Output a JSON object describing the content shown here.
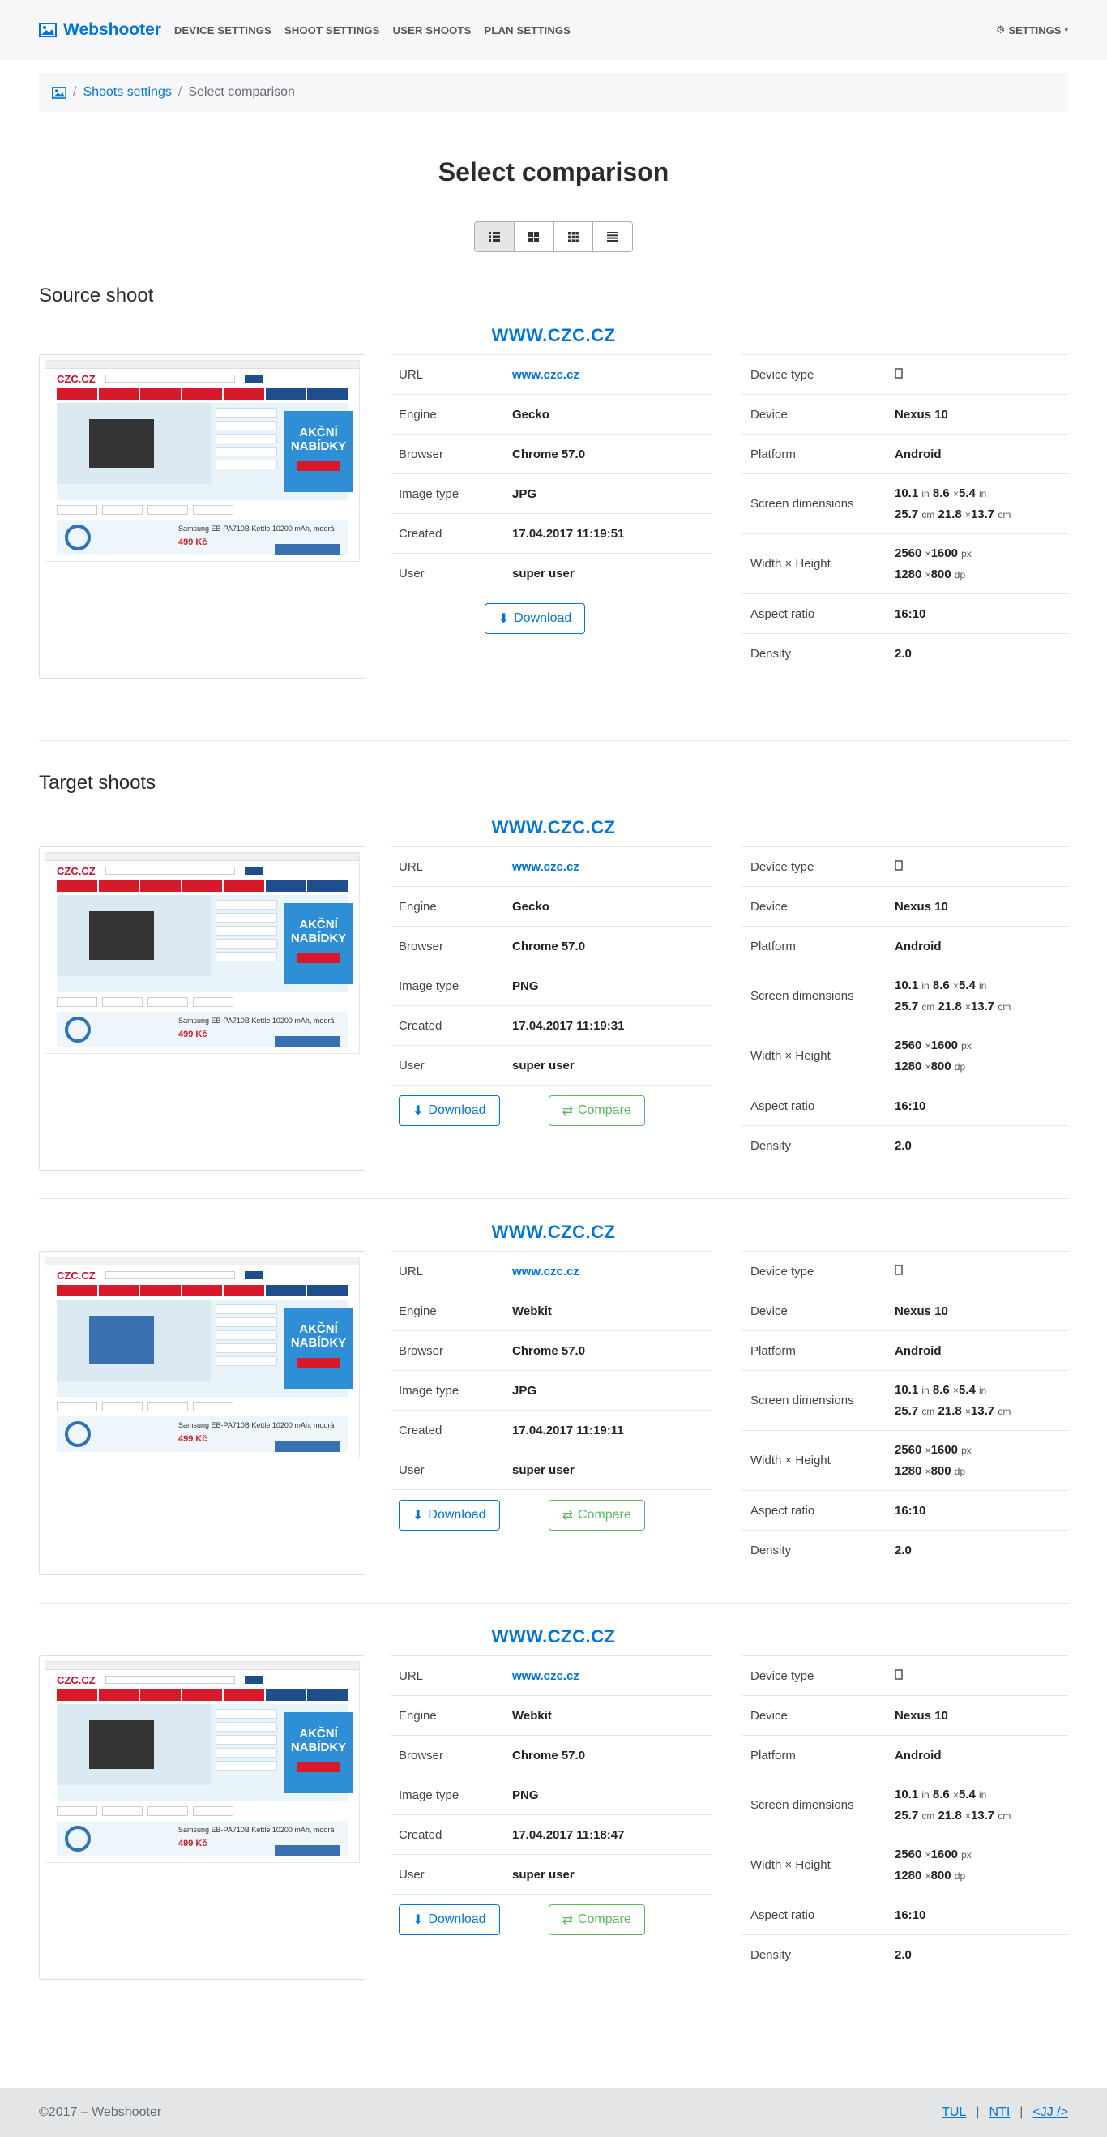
{
  "nav": {
    "brand": "Webshooter",
    "links": [
      "DEVICE SETTINGS",
      "SHOOT SETTINGS",
      "USER SHOOTS",
      "PLAN SETTINGS"
    ],
    "settings": "SETTINGS"
  },
  "breadcrumb": {
    "link": "Shoots settings",
    "current": "Select comparison"
  },
  "page_title": "Select comparison",
  "source_heading": "Source shoot",
  "target_heading": "Target shoots",
  "labels": {
    "url": "URL",
    "engine": "Engine",
    "browser": "Browser",
    "image_type": "Image type",
    "created": "Created",
    "user": "User",
    "device_type": "Device type",
    "device": "Device",
    "platform": "Platform",
    "screen_dimensions": "Screen dimensions",
    "width_height": "Width × Height",
    "aspect_ratio": "Aspect ratio",
    "density": "Density",
    "download": "Download",
    "compare": "Compare"
  },
  "shoots": [
    {
      "heading": "WWW.CZC.CZ",
      "url": "www.czc.cz",
      "engine": "Gecko",
      "browser": "Chrome 57.0",
      "image_type": "JPG",
      "created": "17.04.2017 11:19:51",
      "user": "super user",
      "device": "Nexus 10",
      "platform": "Android",
      "screen_in": [
        "10.1",
        "8.6",
        "5.4"
      ],
      "screen_cm": [
        "25.7",
        "21.8",
        "13.7"
      ],
      "px": [
        "2560",
        "1600"
      ],
      "dp": [
        "1280",
        "800"
      ],
      "aspect": "16:10",
      "density": "2.0"
    },
    {
      "heading": "WWW.CZC.CZ",
      "url": "www.czc.cz",
      "engine": "Gecko",
      "browser": "Chrome 57.0",
      "image_type": "PNG",
      "created": "17.04.2017 11:19:31",
      "user": "super user",
      "device": "Nexus 10",
      "platform": "Android",
      "screen_in": [
        "10.1",
        "8.6",
        "5.4"
      ],
      "screen_cm": [
        "25.7",
        "21.8",
        "13.7"
      ],
      "px": [
        "2560",
        "1600"
      ],
      "dp": [
        "1280",
        "800"
      ],
      "aspect": "16:10",
      "density": "2.0"
    },
    {
      "heading": "WWW.CZC.CZ",
      "url": "www.czc.cz",
      "engine": "Webkit",
      "browser": "Chrome 57.0",
      "image_type": "JPG",
      "created": "17.04.2017 11:19:11",
      "user": "super user",
      "device": "Nexus 10",
      "platform": "Android",
      "screen_in": [
        "10.1",
        "8.6",
        "5.4"
      ],
      "screen_cm": [
        "25.7",
        "21.8",
        "13.7"
      ],
      "px": [
        "2560",
        "1600"
      ],
      "dp": [
        "1280",
        "800"
      ],
      "aspect": "16:10",
      "density": "2.0"
    },
    {
      "heading": "WWW.CZC.CZ",
      "url": "www.czc.cz",
      "engine": "Webkit",
      "browser": "Chrome 57.0",
      "image_type": "PNG",
      "created": "17.04.2017 11:18:47",
      "user": "super user",
      "device": "Nexus 10",
      "platform": "Android",
      "screen_in": [
        "10.1",
        "8.6",
        "5.4"
      ],
      "screen_cm": [
        "25.7",
        "21.8",
        "13.7"
      ],
      "px": [
        "2560",
        "1600"
      ],
      "dp": [
        "1280",
        "800"
      ],
      "aspect": "16:10",
      "density": "2.0"
    }
  ],
  "thumbnail": {
    "logo": "CZC.CZ",
    "promo_line1": "AKČNÍ",
    "promo_line2": "NABÍDKY",
    "product_name": "Samsung EB-PA710B Kettle 10200 mAh, modrá",
    "product_price": "499 Kč"
  },
  "units": {
    "in": "in",
    "cm": "cm",
    "px": "px",
    "dp": "dp",
    "times": "×"
  },
  "footer": {
    "copyright": "©2017 – Webshooter",
    "links": [
      "TUL",
      "NTI",
      "<JJ />"
    ]
  }
}
